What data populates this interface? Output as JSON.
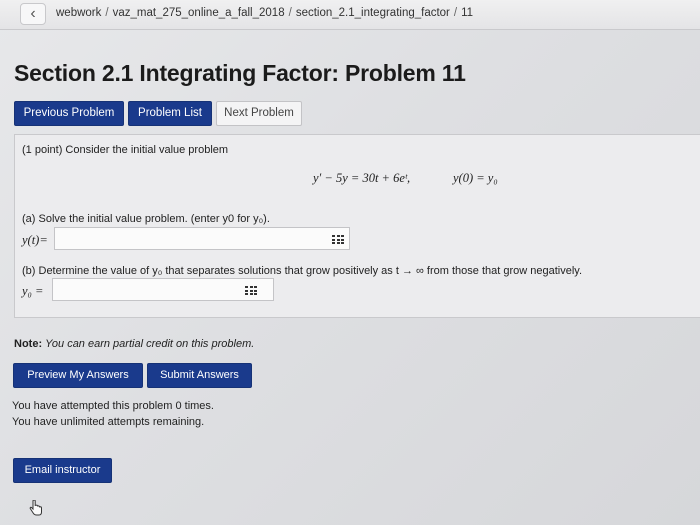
{
  "breadcrumb": {
    "back_glyph": "‹",
    "items": [
      "webwork",
      "vaz_mat_275_online_a_fall_2018",
      "section_2.1_integrating_factor",
      "11"
    ],
    "separator": "/"
  },
  "page": {
    "title": "Section 2.1 Integrating Factor: Problem 11"
  },
  "nav": {
    "previous_label": "Previous Problem",
    "list_label": "Problem List",
    "next_label": "Next Problem"
  },
  "problem": {
    "intro": "(1 point) Consider the initial value problem",
    "equation": "y′ − 5y = 30t + 6eᵗ,",
    "initial_condition": "y(0) = y₀",
    "part_a": "(a) Solve the initial value problem. (enter y0 for y₀).",
    "part_a_label": "y(t)=",
    "part_a_value": "",
    "part_b": "(b) Determine the value of y₀ that separates solutions that grow positively as t → ∞ from those that grow negatively.",
    "part_b_label": "y₀ =",
    "part_b_value": ""
  },
  "note": {
    "label": "Note:",
    "text": "You can earn partial credit on this problem."
  },
  "actions": {
    "preview_label": "Preview My Answers",
    "submit_label": "Submit Answers"
  },
  "status": {
    "attempts": "You have attempted this problem 0 times.",
    "remaining": "You have unlimited attempts remaining."
  },
  "email_label": "Email instructor",
  "colors": {
    "primary_button": "#1a3a8c",
    "background": "#e2e3e5"
  },
  "icons": [
    "chevron-left-icon",
    "equation-editor-icon",
    "hand-cursor-icon"
  ]
}
